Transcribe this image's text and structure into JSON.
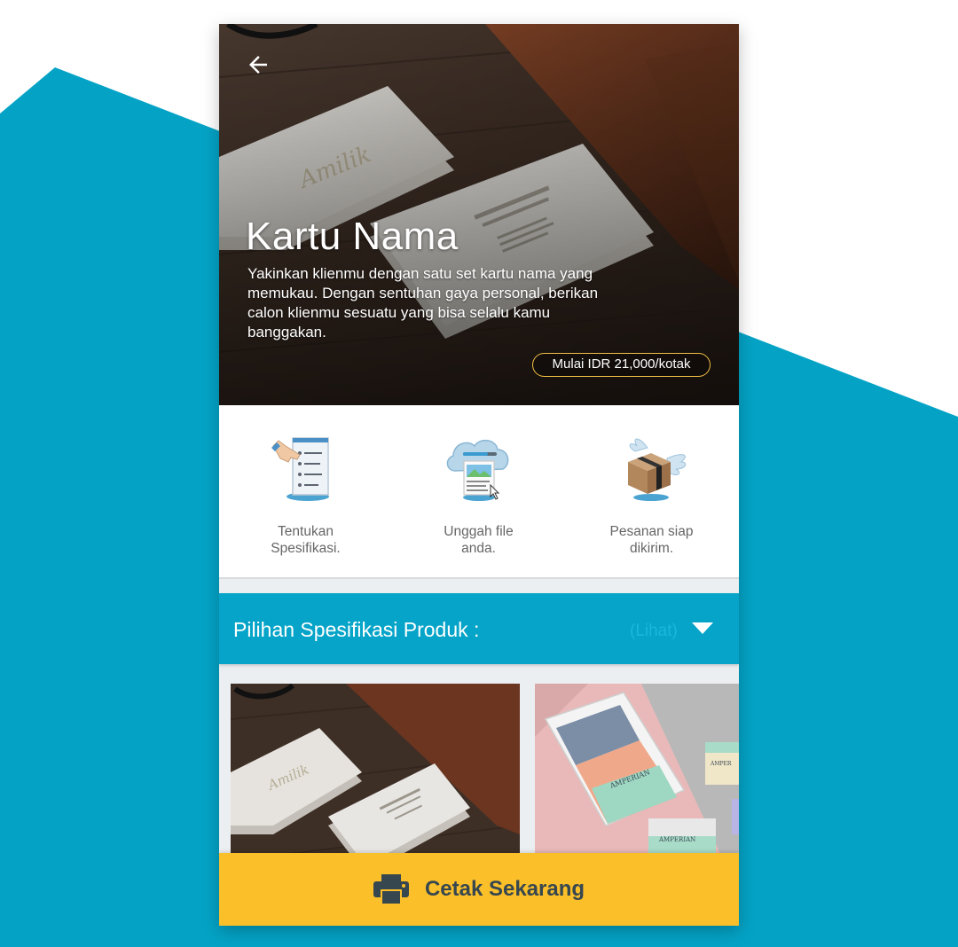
{
  "hero": {
    "title": "Kartu Nama",
    "description": "Yakinkan klienmu dengan satu set kartu nama yang memukau. Dengan sentuhan gaya personal, berikan calon klienmu sesuatu yang bisa selalu kamu banggakan.",
    "price": "Mulai IDR 21,000/kotak"
  },
  "steps": [
    {
      "label": "Tentukan\nSpesifikasi.",
      "icon": "checklist-icon"
    },
    {
      "label": "Unggah file\nanda.",
      "icon": "cloud-upload-icon"
    },
    {
      "label": "Pesanan siap\ndikirim.",
      "icon": "winged-box-icon"
    }
  ],
  "spec": {
    "title": "Pilihan Spesifikasi Produk :",
    "see": "(Lihat)"
  },
  "cta": {
    "label": "Cetak Sekarang"
  },
  "colors": {
    "accent": "#05a4c8",
    "cta": "#fbbf2a",
    "price_border": "#f2c046",
    "background_band": "#04a3c6"
  }
}
